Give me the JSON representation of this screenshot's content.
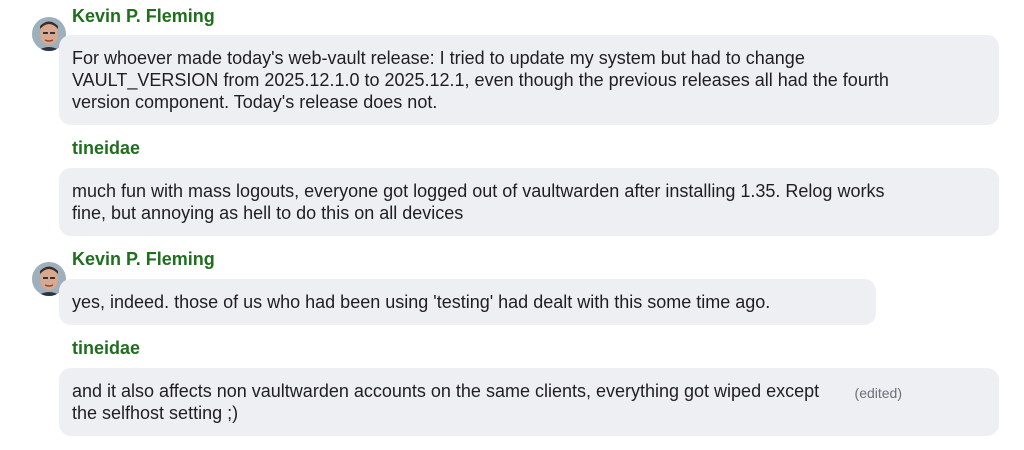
{
  "messages": [
    {
      "sender": "Kevin P. Fleming",
      "avatar": "avatar-kevin",
      "lines": [
        "For whoever made today's web-vault release: I tried to update my system but had to change",
        "VAULT_VERSION from 2025.12.1.0 to 2025.12.1, even though the previous releases all had the fourth",
        "version component. Today's release does not."
      ]
    },
    {
      "sender": "tineidae",
      "lines": [
        "much fun with mass logouts, everyone got logged out of vaultwarden after installing 1.35. Relog works",
        "fine, but annoying as hell to do this on all devices"
      ]
    },
    {
      "sender": "Kevin P. Fleming",
      "avatar": "avatar-kevin",
      "lines": [
        "yes, indeed. those of us who had been using 'testing' had dealt with this some time ago."
      ]
    },
    {
      "sender": "tineidae",
      "edited": "(edited)",
      "lines": [
        "and it also affects non vaultwarden accounts on the same clients, everything got wiped except",
        "the selfhost setting ;)"
      ]
    }
  ],
  "colors": {
    "sender": "#1f6f1f",
    "bubble": "#eeeff3",
    "text": "#1f1f22",
    "muted": "#6e6e78"
  }
}
